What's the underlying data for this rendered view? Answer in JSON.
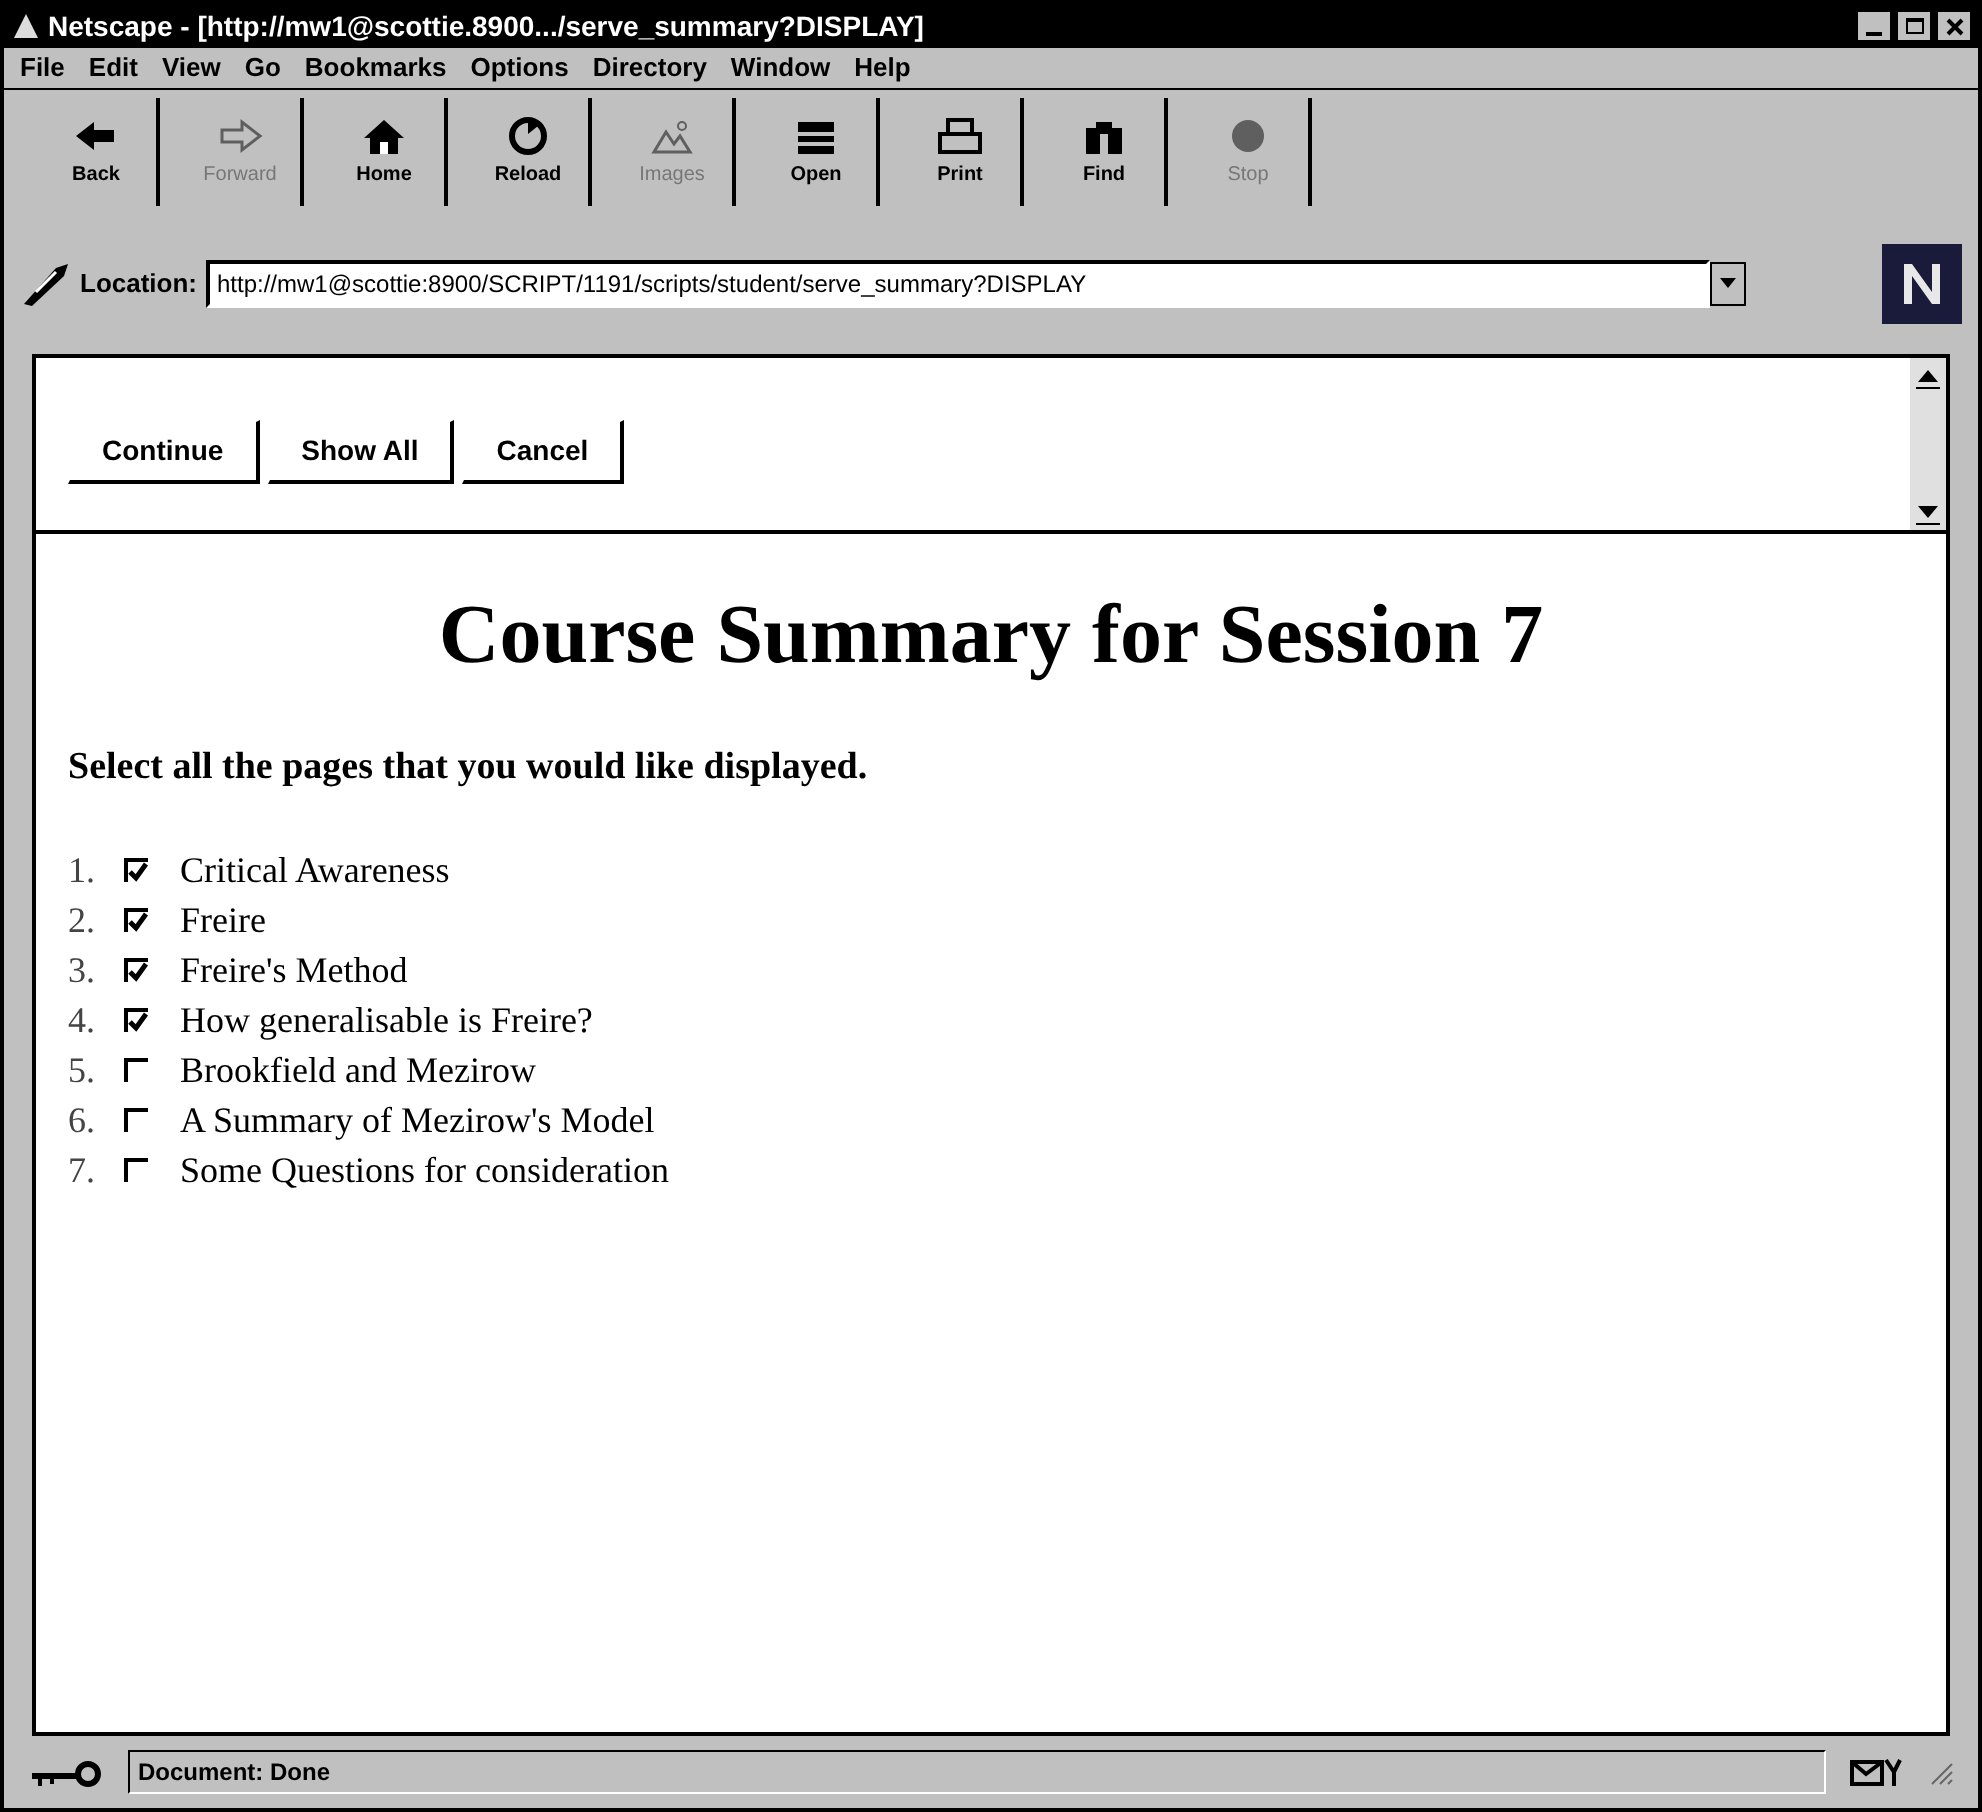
{
  "window": {
    "title": "Netscape - [http://mw1@scottie.8900.../serve_summary?DISPLAY]"
  },
  "menu": [
    "File",
    "Edit",
    "View",
    "Go",
    "Bookmarks",
    "Options",
    "Directory",
    "Window",
    "Help"
  ],
  "toolbar": [
    {
      "label": "Back",
      "disabled": false
    },
    {
      "label": "Forward",
      "disabled": true
    },
    {
      "label": "Home",
      "disabled": false
    },
    {
      "label": "Reload",
      "disabled": false
    },
    {
      "label": "Images",
      "disabled": true
    },
    {
      "label": "Open",
      "disabled": false
    },
    {
      "label": "Print",
      "disabled": false
    },
    {
      "label": "Find",
      "disabled": false
    },
    {
      "label": "Stop",
      "disabled": true
    }
  ],
  "location": {
    "label": "Location:",
    "url": "http://mw1@scottie:8900/SCRIPT/1191/scripts/student/serve_summary?DISPLAY"
  },
  "frame_buttons": [
    "Continue",
    "Show All",
    "Cancel"
  ],
  "heading": "Course Summary for Session 7",
  "instruction": "Select all the pages that you would like displayed.",
  "pages": [
    {
      "number": "1.",
      "label": "Critical Awareness",
      "checked": true
    },
    {
      "number": "2.",
      "label": "Freire",
      "checked": true
    },
    {
      "number": "3.",
      "label": "Freire's Method",
      "checked": true
    },
    {
      "number": "4.",
      "label": "How generalisable is Freire?",
      "checked": true
    },
    {
      "number": "5.",
      "label": "Brookfield and Mezirow",
      "checked": false
    },
    {
      "number": "6.",
      "label": "A Summary of Mezirow's Model",
      "checked": false
    },
    {
      "number": "7.",
      "label": "Some Questions for consideration",
      "checked": false
    }
  ],
  "status_bar": {
    "text": "Document: Done"
  }
}
